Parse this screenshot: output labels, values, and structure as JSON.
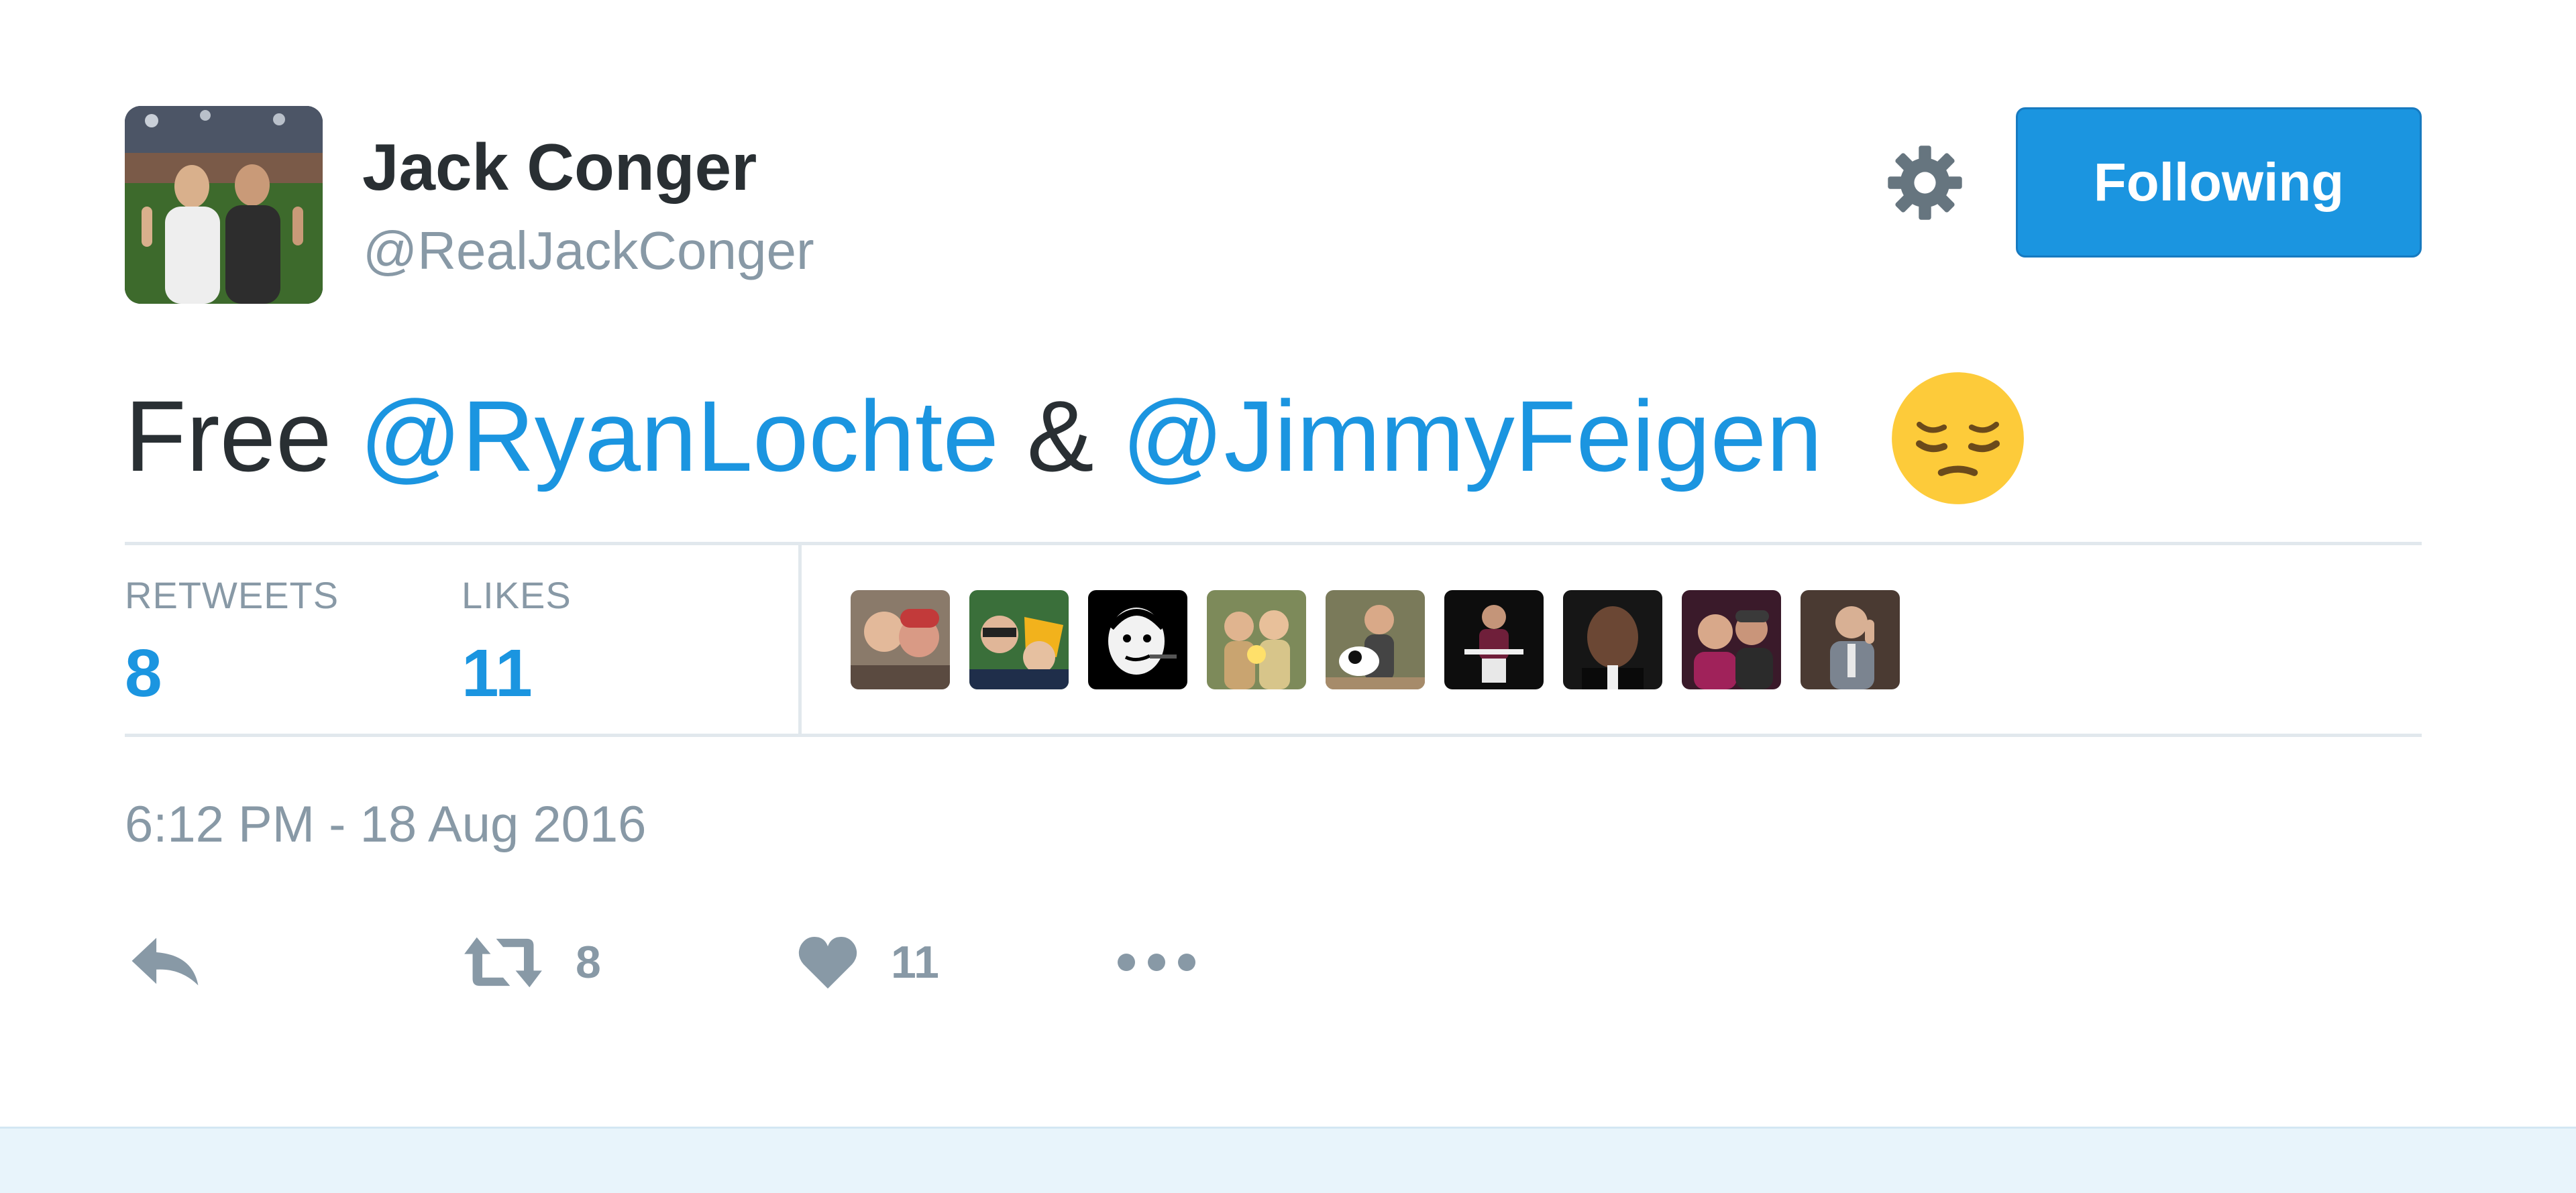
{
  "user": {
    "display_name": "Jack Conger",
    "handle": "@RealJackConger",
    "avatar_icon": "user-avatar-photo"
  },
  "header": {
    "settings_icon": "gear-icon",
    "follow_button_label": "Following"
  },
  "tweet": {
    "text_prefix": "Free ",
    "mention_1": "@RyanLochte",
    "conjunction": " & ",
    "mention_2": "@JimmyFeigen",
    "emoji": "pensive-face-emoji",
    "timestamp": "6:12 PM - 18 Aug 2016"
  },
  "stats": {
    "retweets_label": "RETWEETS",
    "retweets_count": "8",
    "likes_label": "LIKES",
    "likes_count": "11"
  },
  "liker_avatars": [
    {
      "icon": "liker-avatar-1"
    },
    {
      "icon": "liker-avatar-2"
    },
    {
      "icon": "liker-avatar-3"
    },
    {
      "icon": "liker-avatar-4"
    },
    {
      "icon": "liker-avatar-5"
    },
    {
      "icon": "liker-avatar-6"
    },
    {
      "icon": "liker-avatar-7"
    },
    {
      "icon": "liker-avatar-8"
    },
    {
      "icon": "liker-avatar-9"
    }
  ],
  "actions": {
    "reply_icon": "reply-icon",
    "retweet_icon": "retweet-icon",
    "retweet_count": "8",
    "like_icon": "heart-icon",
    "like_count": "11",
    "more_icon": "more-dots-icon"
  },
  "colors": {
    "link": "#1b95e0",
    "button": "#1b95e0",
    "muted": "#8899a6",
    "text": "#292f33",
    "divider": "#e1e8ed",
    "footer_band": "#e8f4fb"
  }
}
